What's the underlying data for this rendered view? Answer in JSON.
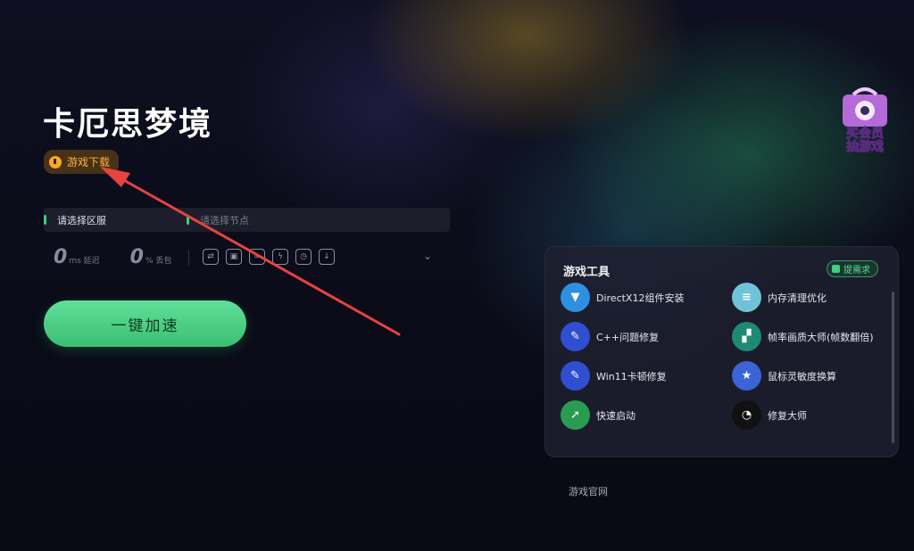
{
  "game": {
    "title": "卡厄思梦境",
    "download_label": "游戏下载"
  },
  "selectors": {
    "region_label": "请选择区服",
    "node_placeholder": "请选择节点"
  },
  "stats": {
    "latency_value": "0",
    "latency_unit": "ms 延迟",
    "loss_value": "0",
    "loss_unit": "% 丢包"
  },
  "tool_icons": [
    "link-icon",
    "image-icon",
    "chain-icon",
    "bolt-icon",
    "gauge-icon",
    "download-icon"
  ],
  "accelerate_label": "一键加速",
  "promo": {
    "line1": "买会员",
    "line2": "抽游戏"
  },
  "panel": {
    "title": "游戏工具",
    "request_label": "提需求",
    "tools": [
      {
        "label": "DirectX12组件安装",
        "icon": "box-icon",
        "color": "#2f8fe0",
        "glyph": "▼"
      },
      {
        "label": "内存清理优化",
        "icon": "memory-icon",
        "color": "#6fc3d8",
        "glyph": "≡"
      },
      {
        "label": "C++问题修复",
        "icon": "wrench-icon",
        "color": "#2f4fd0",
        "glyph": "✎"
      },
      {
        "label": "帧率画质大师(帧数翻倍)",
        "icon": "pixel-icon",
        "color": "#1f8a74",
        "glyph": "▞"
      },
      {
        "label": "Win11卡顿修复",
        "icon": "wrench-icon",
        "color": "#2f4fd0",
        "glyph": "✎"
      },
      {
        "label": "鼠标灵敏度换算",
        "icon": "star-icon",
        "color": "#3b64d6",
        "glyph": "★"
      },
      {
        "label": "快速启动",
        "icon": "launch-icon",
        "color": "#2a9c52",
        "glyph": "➚"
      },
      {
        "label": "修复大师",
        "icon": "fix-master-icon",
        "color": "#111111",
        "glyph": "◔"
      }
    ]
  },
  "footer": {
    "official_site": "游戏官网"
  },
  "colors": {
    "accent_green": "#3bbf72",
    "download_orange": "#ffb23a",
    "arrow_red": "#e8433f"
  }
}
